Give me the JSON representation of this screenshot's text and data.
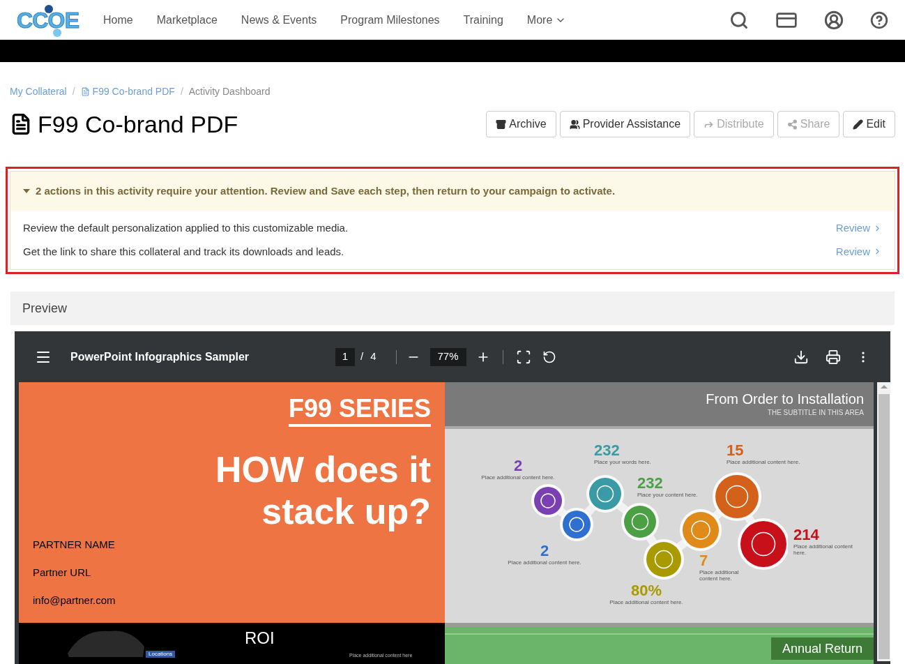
{
  "logo": {
    "text": "CCOE"
  },
  "nav": {
    "items": [
      {
        "label": "Home"
      },
      {
        "label": "Marketplace"
      },
      {
        "label": "News & Events"
      },
      {
        "label": "Program Milestones"
      },
      {
        "label": "Training"
      },
      {
        "label": "More",
        "kind": "dropdown"
      }
    ]
  },
  "breadcrumb": [
    {
      "label": "My Collateral",
      "kind": "link"
    },
    {
      "separator": "/",
      "label": "F99 Co-brand PDF",
      "kind": "file-link"
    },
    {
      "separator": "/",
      "label": "Activity Dashboard",
      "kind": "current"
    }
  ],
  "title": "F99 Co-brand PDF",
  "actions": [
    {
      "label": "Archive",
      "kind": "archive",
      "disabled": false
    },
    {
      "label": "Provider Assistance",
      "kind": "users",
      "disabled": false
    },
    {
      "label": "Distribute",
      "kind": "forward",
      "disabled": true
    },
    {
      "label": "Share",
      "kind": "share",
      "disabled": true
    },
    {
      "label": "Edit",
      "kind": "edit",
      "disabled": false
    }
  ],
  "alert": {
    "expanded": true,
    "message": "2 actions in this activity require your attention. Review and Save each step, then return to your campaign to activate.",
    "tasks": [
      {
        "text": "Review the default personalization applied to this customizable media.",
        "link": "Review"
      },
      {
        "text": "Get the link to share this collateral and track its downloads and leads.",
        "link": "Review"
      }
    ]
  },
  "preview": {
    "heading": "Preview",
    "viewer": {
      "document_title": "PowerPoint Infographics Sampler",
      "page": "1",
      "separator": "/",
      "page_count": "4",
      "zoom": "77%",
      "slides": [
        {
          "kind": "cover",
          "series": "F99 SERIES",
          "headline": "HOW does it stack up?",
          "lines": [
            "PARTNER NAME",
            "Partner URL",
            "info@partner.com"
          ]
        },
        {
          "kind": "infographic",
          "title": "From Order to Installation",
          "subtitle": "THE SUBTITLE IN THIS AREA",
          "items": [
            {
              "number": "2",
              "caption": "Place additional content here.",
              "color": "#7a3fb0"
            },
            {
              "number": "232",
              "caption": "Place your words here.",
              "color": "#3a9aa5"
            },
            {
              "number": "232",
              "caption": "Place your content here.",
              "color": "#4aa043"
            },
            {
              "number": "15",
              "caption": "Place additional content here.",
              "color": "#d4611a"
            },
            {
              "number": "2",
              "caption": "Place additional content here.",
              "color": "#2f6fd0"
            },
            {
              "number": "7",
              "caption": "Place additional content here.",
              "color": "#e08a1a"
            },
            {
              "number": "80%",
              "caption": "Place additional content here.",
              "color": "#a89a00"
            },
            {
              "number": "214",
              "caption": "Place additional content here.",
              "color": "#c8101a"
            }
          ]
        },
        {
          "kind": "roi",
          "title": "ROI",
          "tag": "Locations",
          "caption": "Place additional content here"
        },
        {
          "kind": "banner",
          "title": "Annual Return"
        }
      ]
    }
  }
}
